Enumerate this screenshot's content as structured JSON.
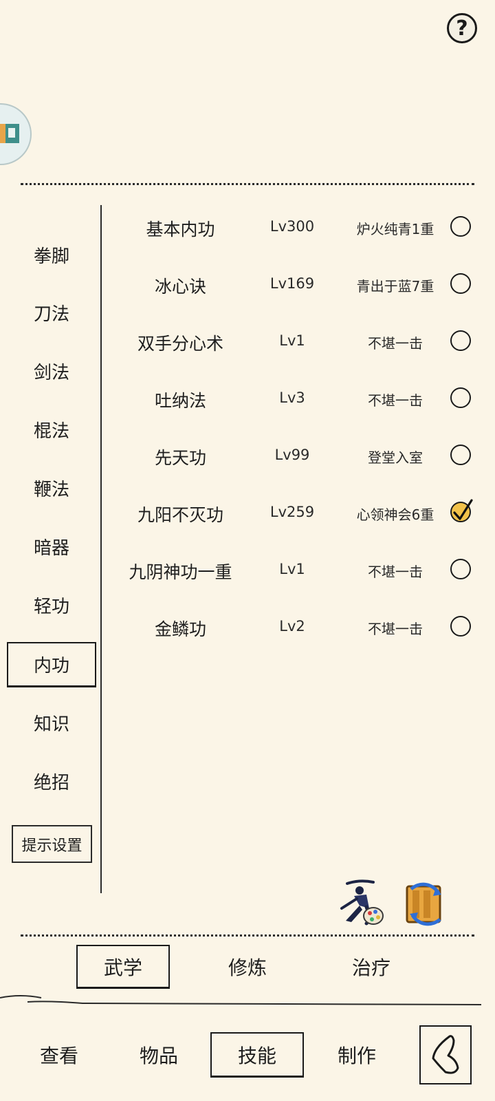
{
  "help": {
    "label": "?"
  },
  "categories": [
    {
      "label": "拳脚",
      "active": false
    },
    {
      "label": "刀法",
      "active": false
    },
    {
      "label": "剑法",
      "active": false
    },
    {
      "label": "棍法",
      "active": false
    },
    {
      "label": "鞭法",
      "active": false
    },
    {
      "label": "暗器",
      "active": false
    },
    {
      "label": "轻功",
      "active": false
    },
    {
      "label": "内功",
      "active": true
    },
    {
      "label": "知识",
      "active": false
    },
    {
      "label": "绝招",
      "active": false
    }
  ],
  "tip_settings_label": "提示设置",
  "skills": [
    {
      "name": "基本内功",
      "level": "Lv300",
      "rank": "炉火纯青1重",
      "checked": false
    },
    {
      "name": "冰心诀",
      "level": "Lv169",
      "rank": "青出于蓝7重",
      "checked": false
    },
    {
      "name": "双手分心术",
      "level": "Lv1",
      "rank": "不堪一击",
      "checked": false
    },
    {
      "name": "吐纳法",
      "level": "Lv3",
      "rank": "不堪一击",
      "checked": false
    },
    {
      "name": "先天功",
      "level": "Lv99",
      "rank": "登堂入室",
      "checked": false
    },
    {
      "name": "九阳不灭功",
      "level": "Lv259",
      "rank": "心领神会6重",
      "checked": true
    },
    {
      "name": "九阴神功一重",
      "level": "Lv1",
      "rank": "不堪一击",
      "checked": false
    },
    {
      "name": "金鳞功",
      "level": "Lv2",
      "rank": "不堪一击",
      "checked": false
    }
  ],
  "tools": [
    {
      "icon": "swordsman-palette-icon"
    },
    {
      "icon": "scroll-swap-icon"
    }
  ],
  "sub_tabs": [
    {
      "label": "武学",
      "active": true
    },
    {
      "label": "修炼",
      "active": false
    },
    {
      "label": "治疗",
      "active": false
    }
  ],
  "nav_tabs": [
    {
      "label": "查看",
      "active": false
    },
    {
      "label": "物品",
      "active": false
    },
    {
      "label": "技能",
      "active": true
    },
    {
      "label": "制作",
      "active": false
    }
  ],
  "colors": {
    "background": "#fbf5e7",
    "ink": "#1e1e1e",
    "check_fill": "#f2c24a"
  }
}
